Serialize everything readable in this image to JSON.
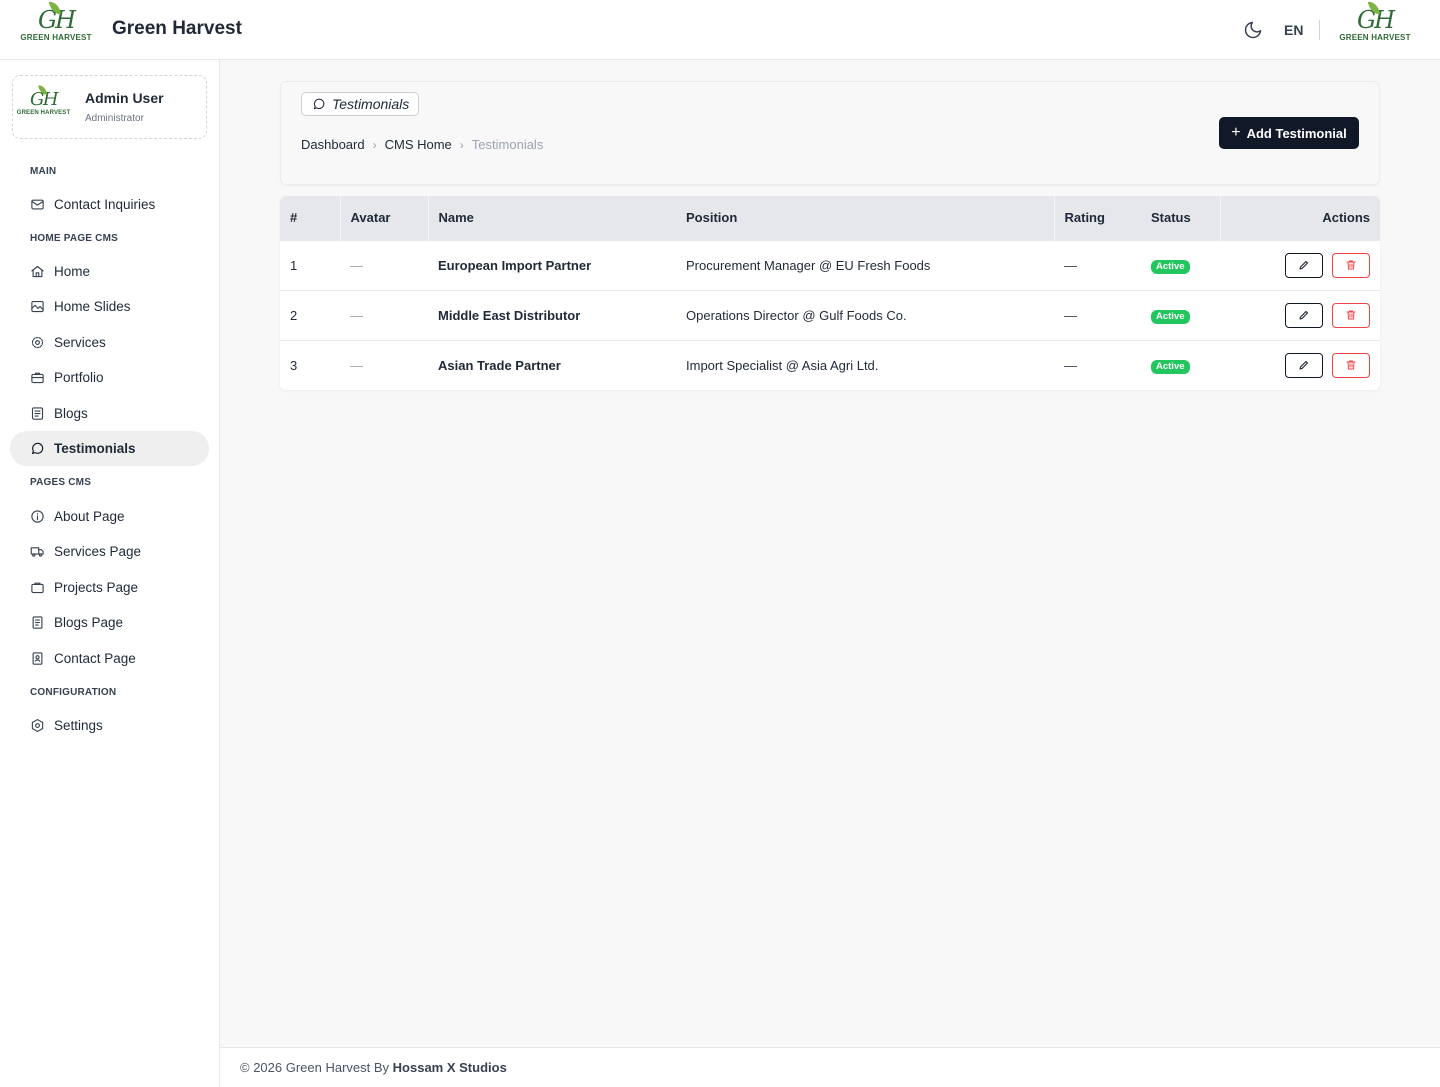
{
  "header": {
    "app_title": "Green Harvest",
    "logo_mark": "GH",
    "logo_text": "GREEN HARVEST",
    "language": "EN"
  },
  "user": {
    "name": "Admin User",
    "role": "Administrator"
  },
  "sidebar": {
    "sections": {
      "main": "MAIN",
      "home_page_cms": "HOME PAGE CMS",
      "pages_cms": "PAGES CMS",
      "configuration": "CONFIGURATION"
    },
    "items": {
      "contact_inquiries": "Contact Inquiries",
      "home": "Home",
      "home_slides": "Home Slides",
      "services": "Services",
      "portfolio": "Portfolio",
      "blogs": "Blogs",
      "testimonials": "Testimonials",
      "about_page": "About Page",
      "services_page": "Services Page",
      "projects_page": "Projects Page",
      "blogs_page": "Blogs Page",
      "contact_page": "Contact Page",
      "settings": "Settings"
    },
    "active": "testimonials"
  },
  "page": {
    "tag": "Testimonials",
    "breadcrumb": [
      "Dashboard",
      "CMS Home",
      "Testimonials"
    ],
    "add_button": "Add Testimonial"
  },
  "table": {
    "columns": [
      "#",
      "Avatar",
      "Name",
      "Position",
      "Rating",
      "Status",
      "Actions"
    ],
    "rows": [
      {
        "num": "1",
        "avatar": "—",
        "name": "European Import Partner",
        "position": "Procurement Manager @ EU Fresh Foods",
        "rating": "—",
        "status": "Active"
      },
      {
        "num": "2",
        "avatar": "—",
        "name": "Middle East Distributor",
        "position": "Operations Director @ Gulf Foods Co.",
        "rating": "—",
        "status": "Active"
      },
      {
        "num": "3",
        "avatar": "—",
        "name": "Asian Trade Partner",
        "position": "Import Specialist @ Asia Agri Ltd.",
        "rating": "—",
        "status": "Active"
      }
    ]
  },
  "footer": {
    "prefix": "© 2026 Green Harvest By ",
    "studio": "Hossam X Studios"
  },
  "colors": {
    "brand_green": "#2f6b36",
    "status_active": "#22c55e",
    "primary_button": "#111827",
    "danger": "#ef4444"
  },
  "icons": {
    "theme_toggle": "moon-icon",
    "edit": "pencil-icon",
    "delete": "trash-icon"
  }
}
